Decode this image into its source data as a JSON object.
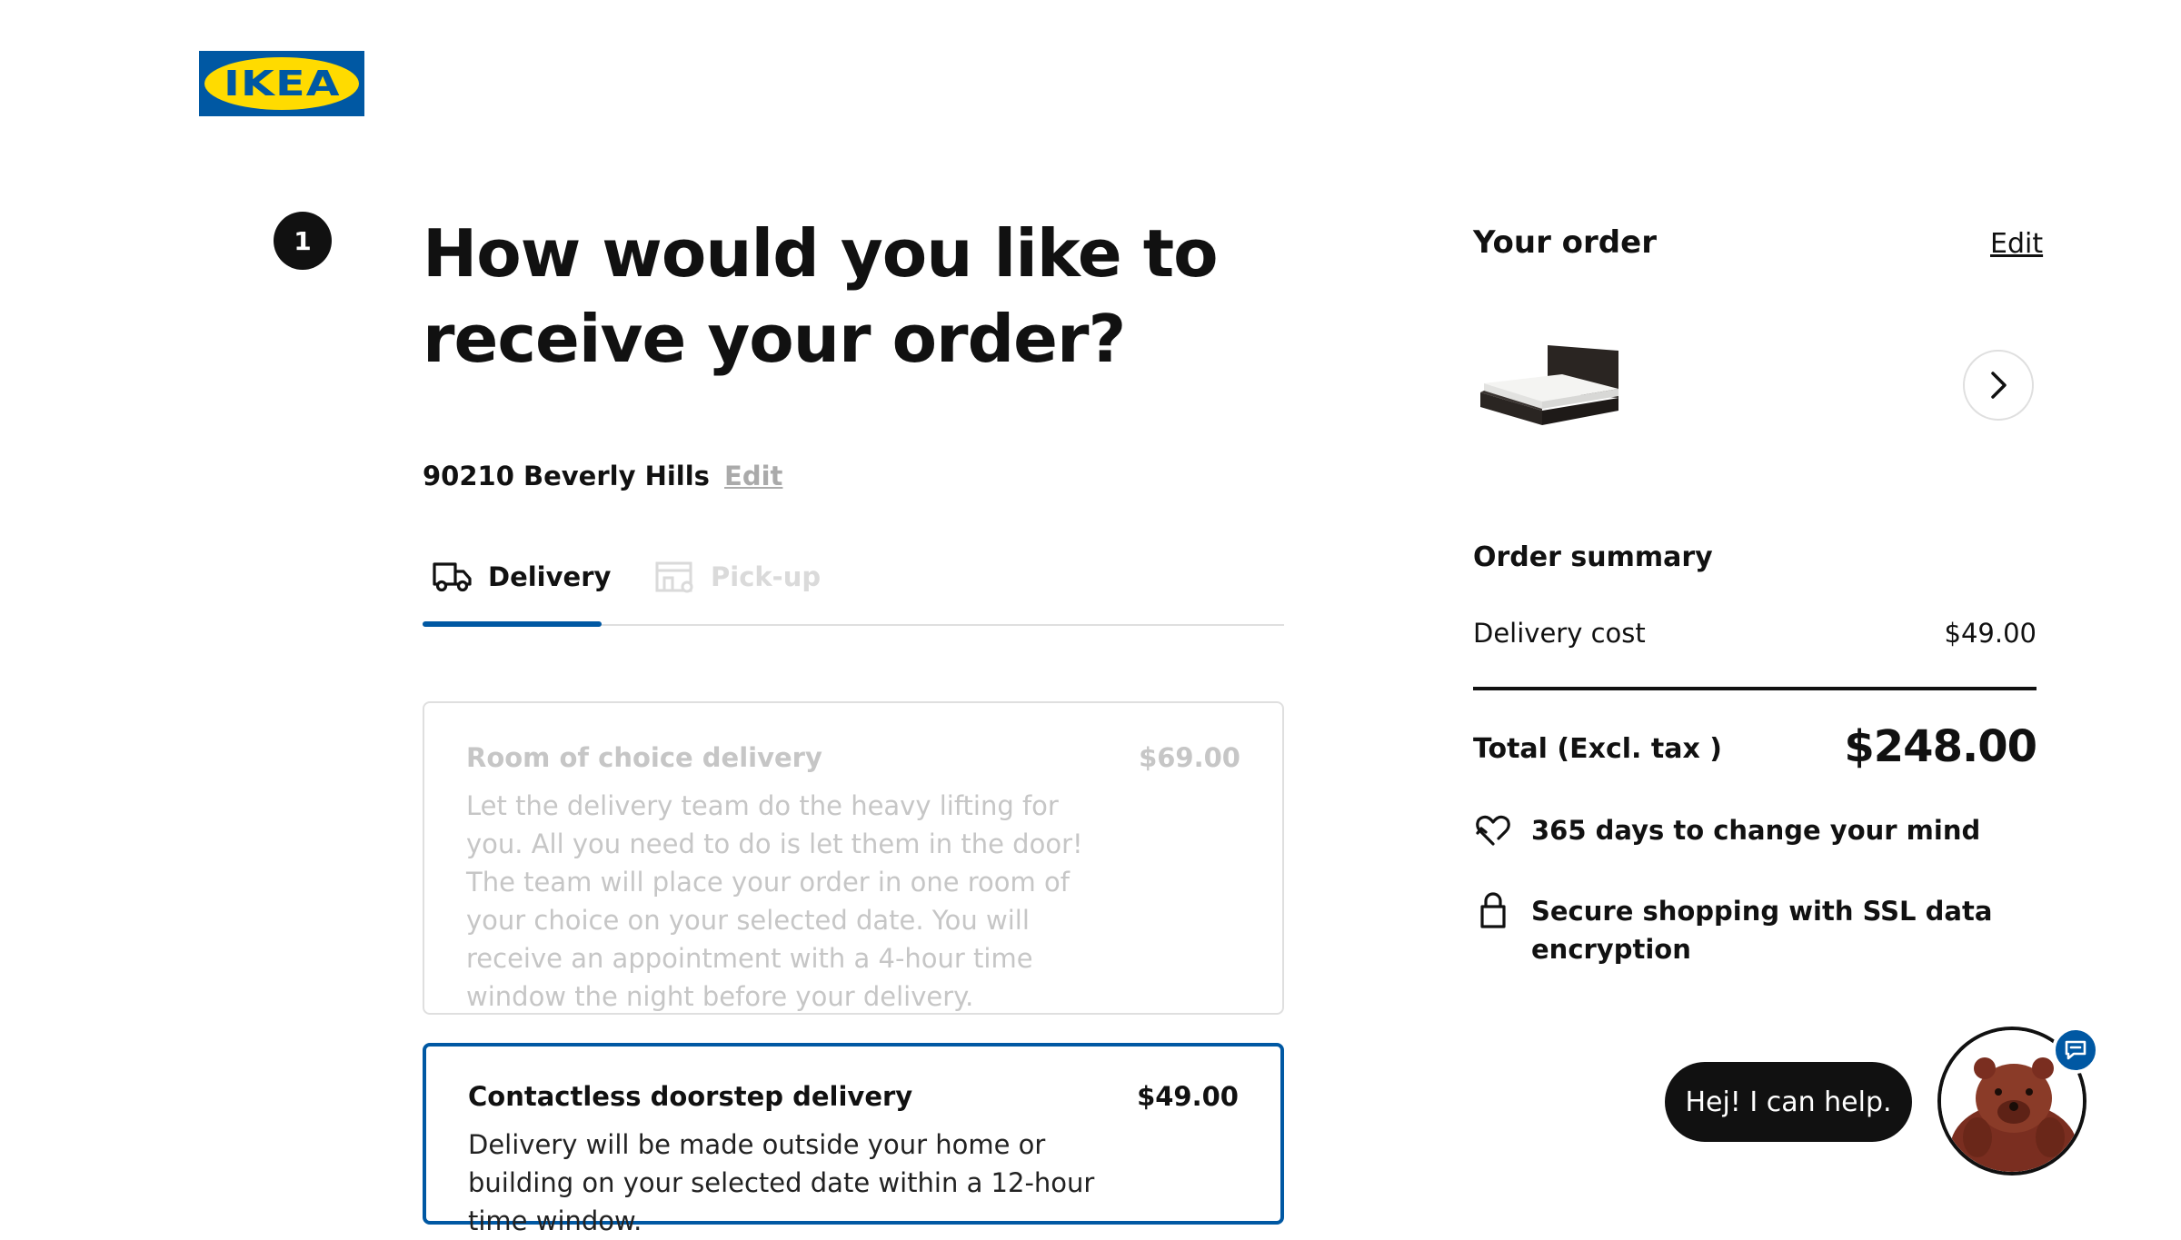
{
  "brand": {
    "logo_text": "IKEA",
    "primary": "#0058a3",
    "secondary": "#ffdb00"
  },
  "step": {
    "number": "1",
    "title_line1": "How would you like to",
    "title_line2": "receive your order?"
  },
  "location": {
    "zip_city": "90210 Beverly Hills",
    "edit_label": "Edit"
  },
  "tabs": [
    {
      "label": "Delivery",
      "icon": "truck-icon",
      "selected": true
    },
    {
      "label": "Pick-up",
      "icon": "store-icon",
      "selected": false
    }
  ],
  "delivery_options": [
    {
      "title": "Room of choice delivery",
      "price": "$69.00",
      "description": "Let the delivery team do the heavy lifting for you. All you need to do is let them in the door! The team will place your order in one room of your choice on your selected date. You will receive an appointment with a 4-hour time window the night before your delivery.",
      "state": "disabled"
    },
    {
      "title": "Contactless doorstep delivery",
      "price": "$49.00",
      "description": "Delivery will be made outside your home or building on your selected date within a 12-hour time window.",
      "state": "selected"
    }
  ],
  "order": {
    "title": "Your order",
    "edit_label": "Edit",
    "product_icon": "bed-product-image",
    "next_icon": "chevron-right-icon"
  },
  "summary": {
    "title": "Order summary",
    "delivery_label": "Delivery cost",
    "delivery_value": "$49.00",
    "total_label": "Total (Excl. tax )",
    "total_value": "$248.00"
  },
  "perks": [
    {
      "icon": "heart-return-icon",
      "text": "365 days to change your mind"
    },
    {
      "icon": "lock-icon",
      "text": "Secure shopping with SSL data encryption"
    }
  ],
  "chat": {
    "bubble_text": "Hej! I can help.",
    "avatar": "bear-avatar",
    "badge_icon": "chat-icon"
  }
}
